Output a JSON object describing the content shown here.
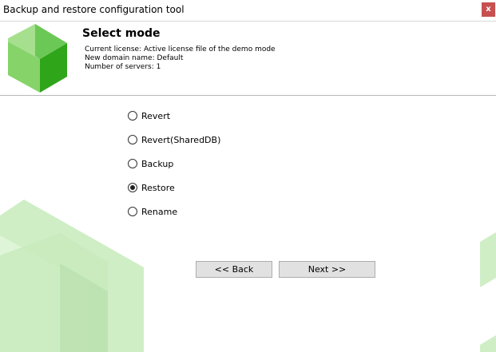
{
  "window": {
    "title": "Backup and restore configuration tool",
    "close_label": "x"
  },
  "header": {
    "title": "Select mode",
    "license_line": "Current license: Active license file of the demo mode",
    "domain_line": "New domain name: Default",
    "servers_line": "Number of servers: 1"
  },
  "options": [
    {
      "label": "Revert",
      "checked": false
    },
    {
      "label": "Revert(SharedDB)",
      "checked": false
    },
    {
      "label": "Backup",
      "checked": false
    },
    {
      "label": "Restore",
      "checked": true
    },
    {
      "label": "Rename",
      "checked": false
    }
  ],
  "buttons": {
    "back_label": "<< Back",
    "next_label": "Next >>"
  },
  "colors": {
    "accent_dark": "#2fa51a",
    "accent_light": "#7fd36b",
    "deco": "#c9eec2"
  }
}
